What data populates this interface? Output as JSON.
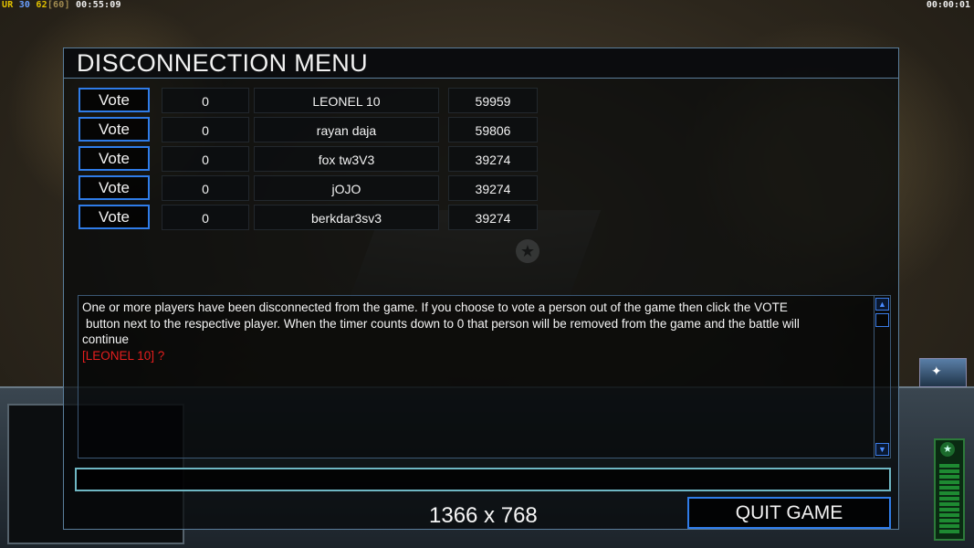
{
  "hud": {
    "top_left": {
      "ur": "UR",
      "val1": "30",
      "val2": "62",
      "val3": "[60]",
      "time": "00:55:09"
    },
    "top_right_time": "00:00:01"
  },
  "dialog": {
    "title": "DISCONNECTION MENU",
    "players": [
      {
        "vote_label": "Vote",
        "timer": "0",
        "name": "LEONEL 10",
        "ping": "59959"
      },
      {
        "vote_label": "Vote",
        "timer": "0",
        "name": "rayan daja",
        "ping": "59806"
      },
      {
        "vote_label": "Vote",
        "timer": "0",
        "name": "fox tw3V3",
        "ping": "39274"
      },
      {
        "vote_label": "Vote",
        "timer": "0",
        "name": "jOJO",
        "ping": "39274"
      },
      {
        "vote_label": "Vote",
        "timer": "0",
        "name": "berkdar3sv3",
        "ping": "39274"
      }
    ],
    "message": {
      "line1": "One or more players have been disconnected from the game. If you choose to vote a person out of the game then click the VOTE",
      "line2": "button next to the respective player. When the timer counts down to 0 that person will be removed from the game and the battle will",
      "line3": "continue",
      "line4": "[LEONEL 10] ?"
    },
    "chat_input_value": "",
    "resolution_text": "1366 x 768",
    "quit_label": "QUIT GAME"
  },
  "colors": {
    "accent_blue": "#2f7ce8",
    "alert_red": "#e61e1e",
    "input_border": "#6fb7c4"
  }
}
